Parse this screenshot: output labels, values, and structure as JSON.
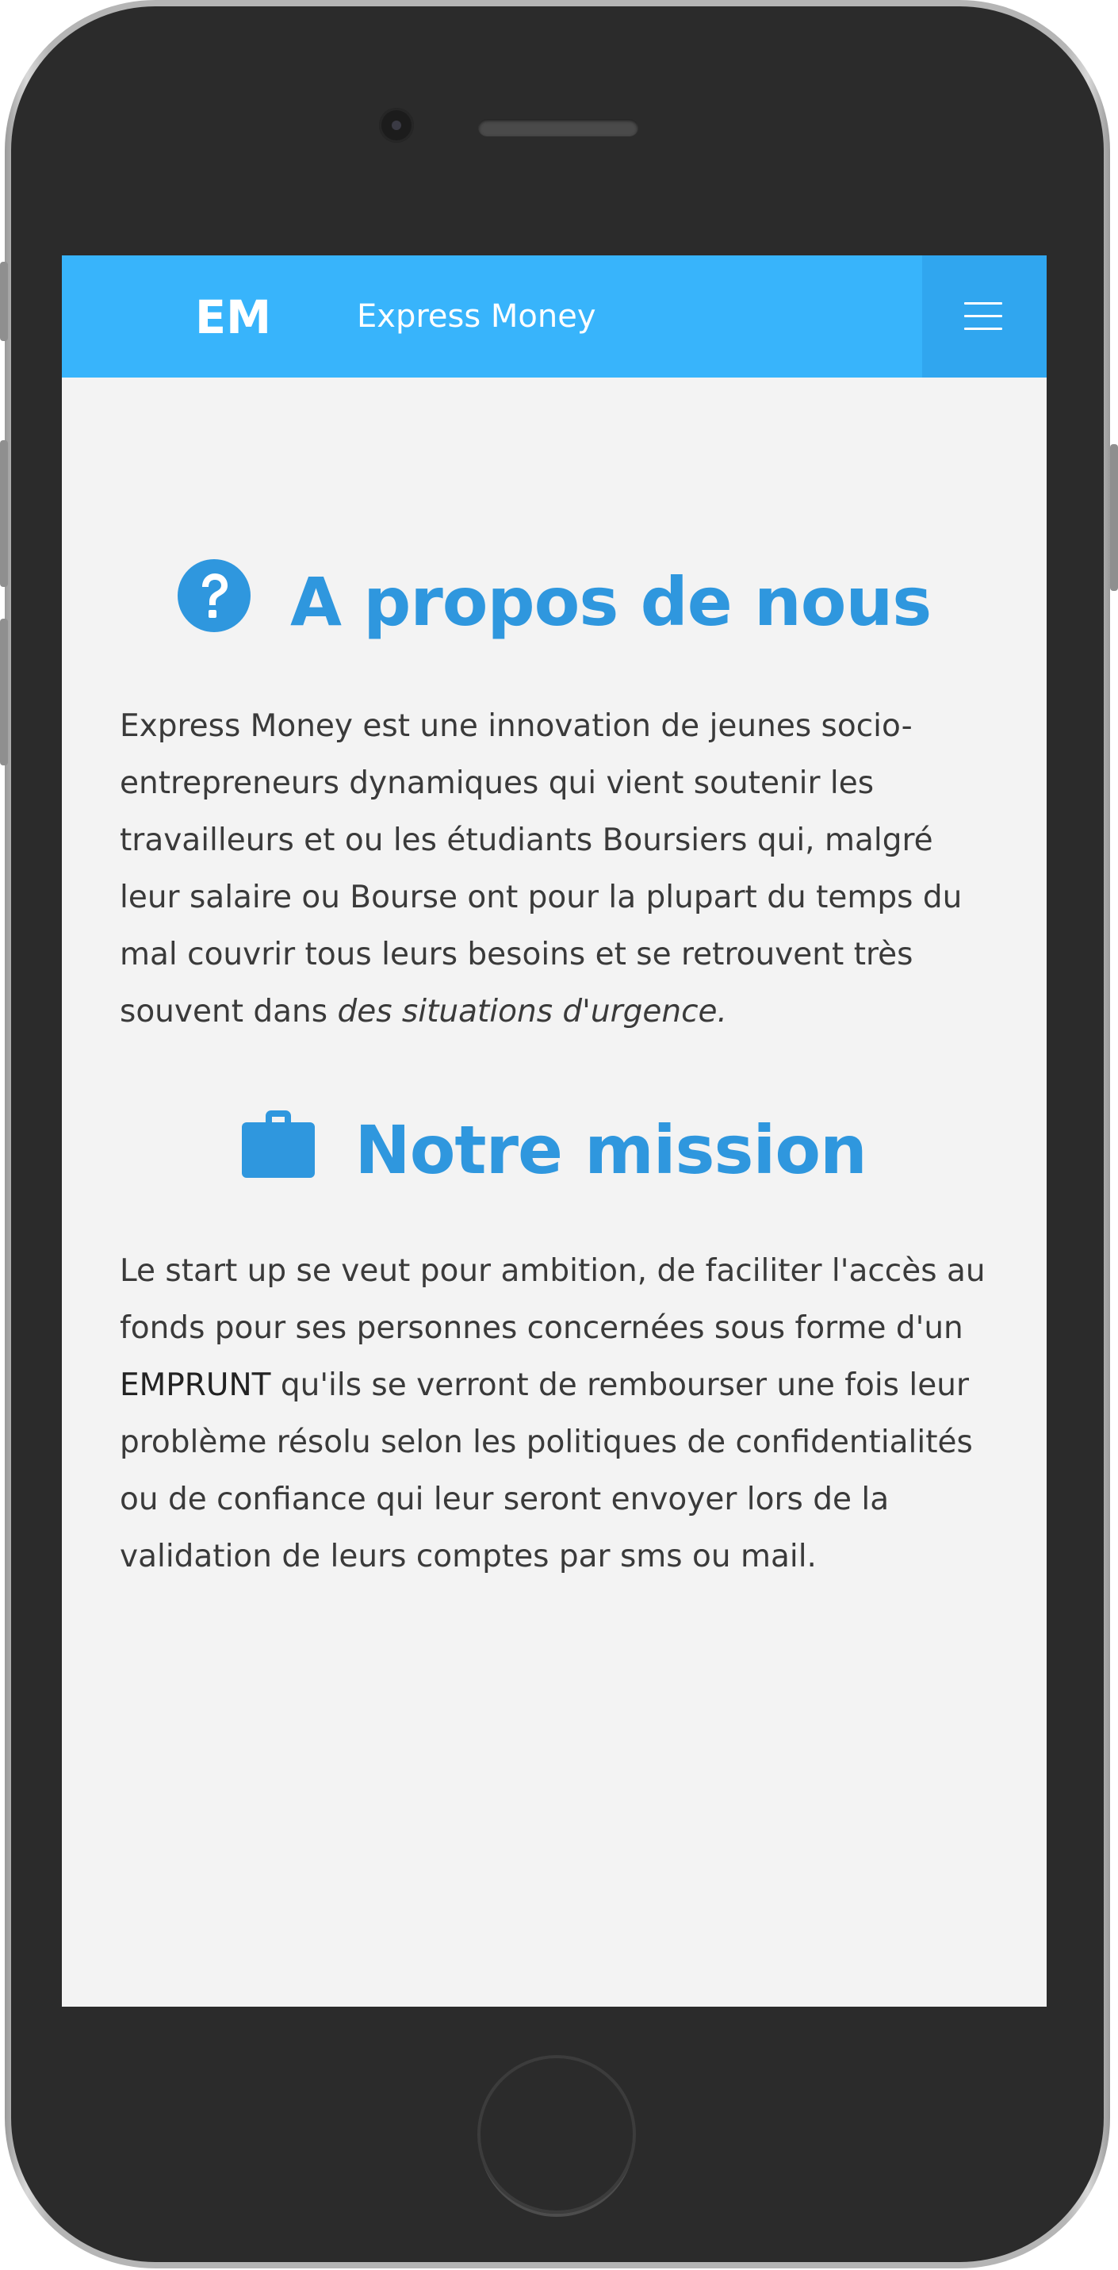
{
  "navbar": {
    "logo_text": "EM",
    "brand": "Express Money",
    "menu_icon": "hamburger-menu-icon",
    "background_color": "#38b4fb",
    "toggle_color": "#30a6ef"
  },
  "about": {
    "icon": "question-circle-icon",
    "title": "A propos de nous",
    "paragraph_main": "Express Money est une innovation de jeunes socio-entrepreneurs dynamiques qui vient soutenir les travailleurs et ou les étudiants Boursiers qui, malgré leur salaire ou Bourse ont pour la plupart du temps du mal couvrir tous leurs besoins et se retrouvent très souvent dans ",
    "paragraph_emphasis": "des situations d'urgence."
  },
  "mission": {
    "icon": "briefcase-icon",
    "title": "Notre mission",
    "paragraph_before": "Le start up se veut pour ambition, de faciliter l'accès au fonds pour ses personnes concernées sous forme d'un ",
    "paragraph_keyword": "EMPRUNT",
    "paragraph_after": " qu'ils se verront de rembourser une fois leur problème résolu selon les politiques de confidentialités ou de confiance qui leur seront envoyer lors de la validation de leurs comptes par sms ou mail."
  },
  "colors": {
    "heading": "#2f97de",
    "body_text": "#3a3a3a",
    "page_background": "#f3f3f3"
  }
}
